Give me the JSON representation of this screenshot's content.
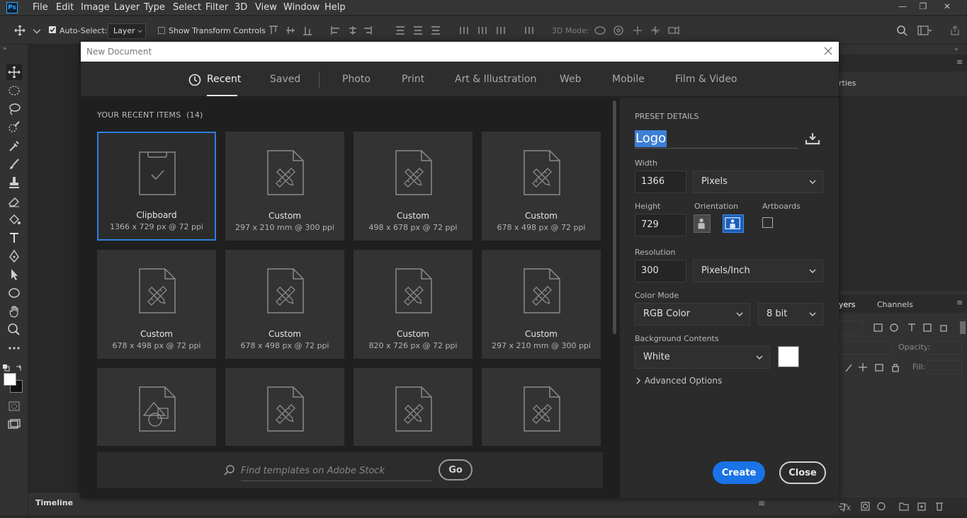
{
  "menubar": {
    "logo": "Ps",
    "items": [
      "File",
      "Edit",
      "Image",
      "Layer",
      "Type",
      "Select",
      "Filter",
      "3D",
      "View",
      "Window",
      "Help"
    ]
  },
  "options": {
    "auto_select_label": "Auto-Select:",
    "auto_select_value": "Layer",
    "show_transform_label": "Show Transform Controls",
    "mode_3d_label": "3D Mode:"
  },
  "right_panel": {
    "properties_label": "rties",
    "layers_tab": "yers",
    "channels_tab": "Channels",
    "opacity_label": "Opacity:",
    "fill_label": "Fill:"
  },
  "timeline": {
    "label": "Timeline"
  },
  "dialog": {
    "title": "New Document",
    "tabs": [
      {
        "label": "Recent"
      },
      {
        "label": "Saved"
      },
      {
        "label": "Photo"
      },
      {
        "label": "Print"
      },
      {
        "label": "Art & Illustration"
      },
      {
        "label": "Web"
      },
      {
        "label": "Mobile"
      },
      {
        "label": "Film & Video"
      }
    ],
    "recent_heading": "YOUR RECENT ITEMS",
    "recent_count": "(14)",
    "items": [
      {
        "name": "Clipboard",
        "dims": "1366 x 729 px @ 72 ppi",
        "icon": "clipboard-icon"
      },
      {
        "name": "Custom",
        "dims": "297 x 210 mm @ 300 ppi",
        "icon": "custom-doc-icon"
      },
      {
        "name": "Custom",
        "dims": "498 x 678 px @ 72 ppi",
        "icon": "custom-doc-icon"
      },
      {
        "name": "Custom",
        "dims": "678 x 498 px @ 72 ppi",
        "icon": "custom-doc-icon"
      },
      {
        "name": "Custom",
        "dims": "678 x 498 px @ 72 ppi",
        "icon": "custom-doc-icon"
      },
      {
        "name": "Custom",
        "dims": "678 x 498 px @ 72 ppi",
        "icon": "custom-doc-icon"
      },
      {
        "name": "Custom",
        "dims": "820 x 726 px @ 72 ppi",
        "icon": "custom-doc-icon"
      },
      {
        "name": "Custom",
        "dims": "297 x 210 mm @ 300 ppi",
        "icon": "custom-doc-icon"
      },
      {
        "name": "",
        "dims": "",
        "icon": "shapes-doc-icon"
      },
      {
        "name": "",
        "dims": "",
        "icon": "custom-doc-icon"
      },
      {
        "name": "",
        "dims": "",
        "icon": "custom-doc-icon"
      },
      {
        "name": "",
        "dims": "",
        "icon": "custom-doc-icon"
      }
    ],
    "search_placeholder": "Find templates on Adobe Stock",
    "go_label": "Go",
    "preset": {
      "heading": "PRESET DETAILS",
      "name": "Logo",
      "width_label": "Width",
      "width_value": "1366",
      "width_unit": "Pixels",
      "height_label": "Height",
      "height_value": "729",
      "orientation_label": "Orientation",
      "artboards_label": "Artboards",
      "resolution_label": "Resolution",
      "resolution_value": "300",
      "resolution_unit": "Pixels/Inch",
      "color_mode_label": "Color Mode",
      "color_mode_value": "RGB Color",
      "bit_depth_value": "8 bit",
      "background_label": "Background Contents",
      "background_value": "White",
      "background_color": "#ffffff",
      "advanced_label": "Advanced Options"
    },
    "create_label": "Create",
    "close_label": "Close"
  }
}
